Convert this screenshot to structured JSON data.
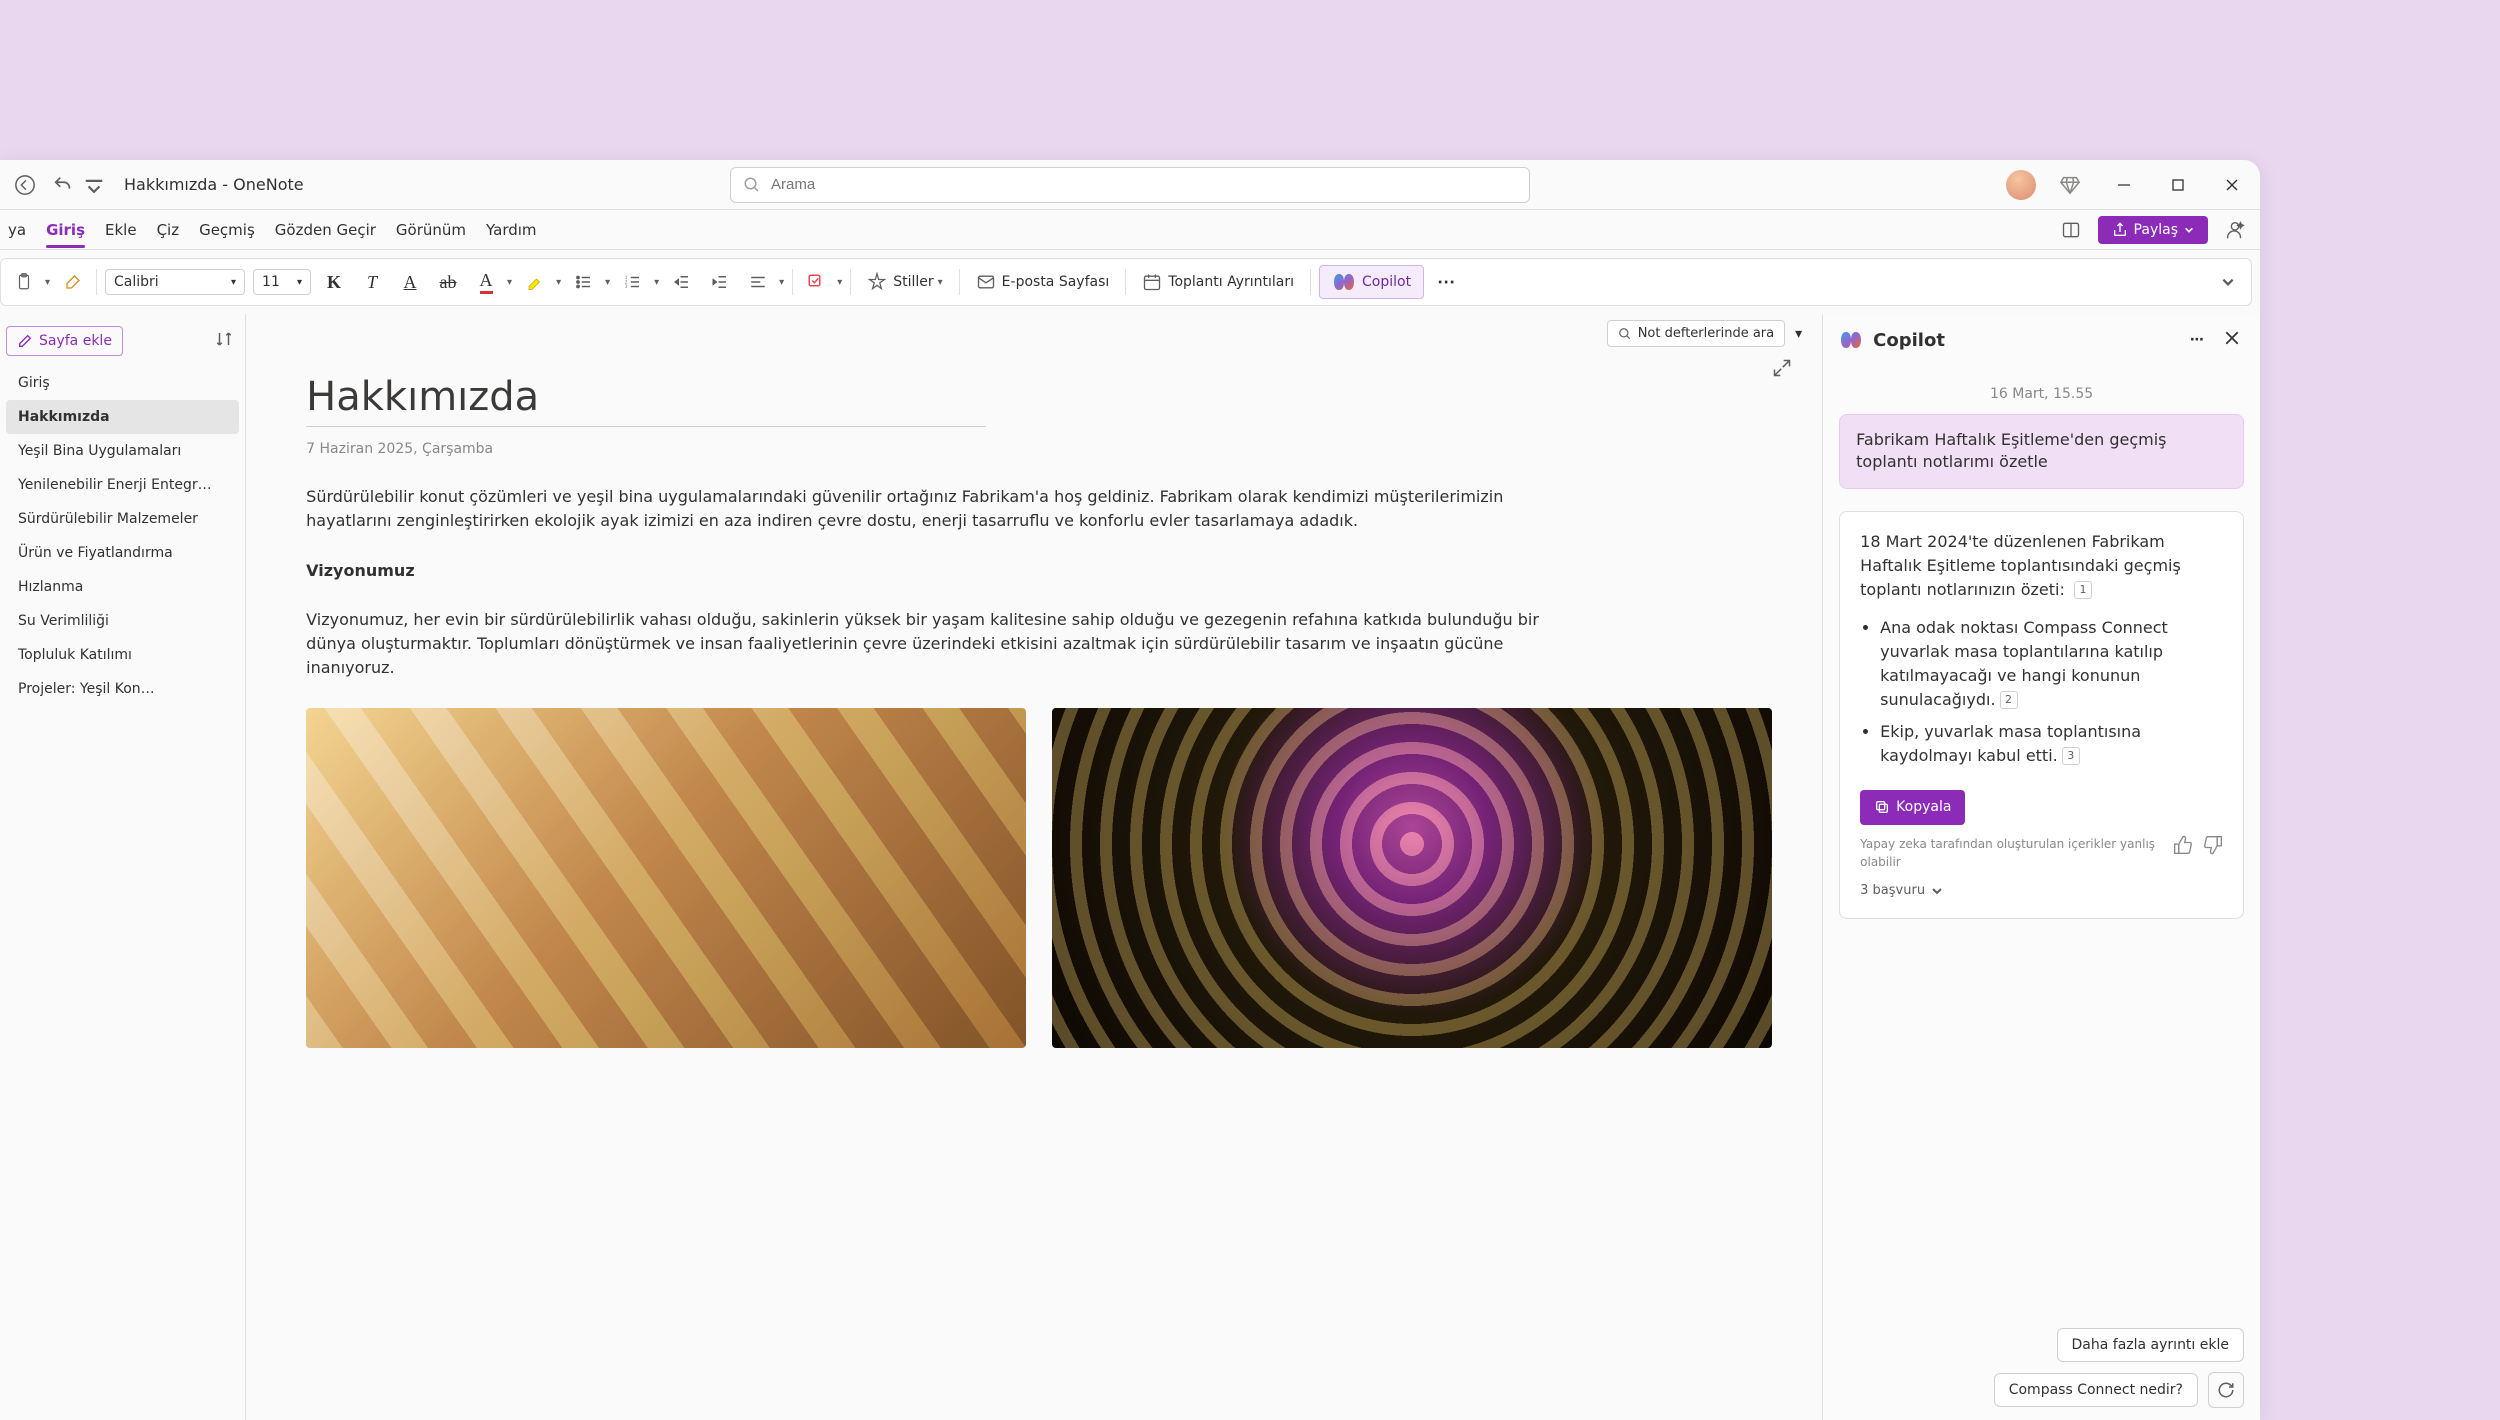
{
  "titlebar": {
    "app_title": "Hakkımızda - OneNote",
    "search_placeholder": "Arama"
  },
  "ribbon": {
    "tabs": [
      "ya",
      "Giriş",
      "Ekle",
      "Çiz",
      "Geçmiş",
      "Gözden Geçir",
      "Görünüm",
      "Yardım"
    ],
    "active_index": 1,
    "share_label": "Paylaş"
  },
  "toolbar": {
    "font_name": "Calibri",
    "font_size": "11",
    "styles_label": "Stiller",
    "email_page_label": "E-posta Sayfası",
    "meeting_details_label": "Toplantı Ayrıntıları",
    "copilot_label": "Copilot"
  },
  "search_notebooks_label": "Not defterlerinde ara",
  "page_list": {
    "add_page_label": "Sayfa ekle",
    "items": [
      "Giriş",
      "Hakkımızda",
      "Yeşil Bina Uygulamaları",
      "Yenilenebilir Enerji Entegr…",
      "Sürdürülebilir Malzemeler",
      "Ürün ve Fiyatlandırma",
      "Hızlanma",
      "Su Verimliliği",
      "Topluluk Katılımı",
      "Projeler: Yeşil Kon…"
    ],
    "active_index": 1
  },
  "document": {
    "title": "Hakkımızda",
    "date": "7 Haziran 2025, Çarşamba",
    "intro": "Sürdürülebilir konut çözümleri ve yeşil bina uygulamalarındaki güvenilir ortağınız Fabrikam'a hoş geldiniz. Fabrikam olarak kendimizi müşterilerimizin hayatlarını zenginleştirirken ekolojik ayak izimizi en aza indiren çevre dostu, enerji tasarruflu ve konforlu evler tasarlamaya adadık.",
    "vision_heading": "Vizyonumuz",
    "vision_body": "Vizyonumuz, her evin bir sürdürülebilirlik vahası olduğu, sakinlerin yüksek bir yaşam kalitesine sahip olduğu ve gezegenin refahına katkıda bulunduğu bir dünya oluşturmaktır. Toplumları dönüştürmek ve insan faaliyetlerinin çevre üzerindeki etkisini azaltmak için sürdürülebilir tasarım ve inşaatın gücüne inanıyoruz."
  },
  "copilot": {
    "title": "Copilot",
    "timestamp": "16 Mart, 15.55",
    "user_prompt": "Fabrikam Haftalık Eşitleme'den geçmiş toplantı notlarımı özetle",
    "ai_intro": "18 Mart 2024'te düzenlenen Fabrikam Haftalık Eşitleme toplantısındaki geçmiş toplantı notlarınızın özeti:",
    "bullets": [
      "Ana odak noktası Compass Connect yuvarlak masa toplantılarına katılıp katılmayacağı ve hangi konunun sunulacağıydı.",
      "Ekip, yuvarlak masa toplantısına kaydolmayı kabul etti."
    ],
    "bullet_refs": [
      "2",
      "3"
    ],
    "intro_ref": "1",
    "copy_label": "Kopyala",
    "disclaimer": "Yapay zeka tarafından oluşturulan içerikler yanlış olabilir",
    "refs_label": "3 başvuru",
    "suggestion_1": "Daha fazla ayrıntı ekle",
    "suggestion_2": "Compass Connect nedir?"
  },
  "colors": {
    "accent": "#8b2bb8"
  }
}
